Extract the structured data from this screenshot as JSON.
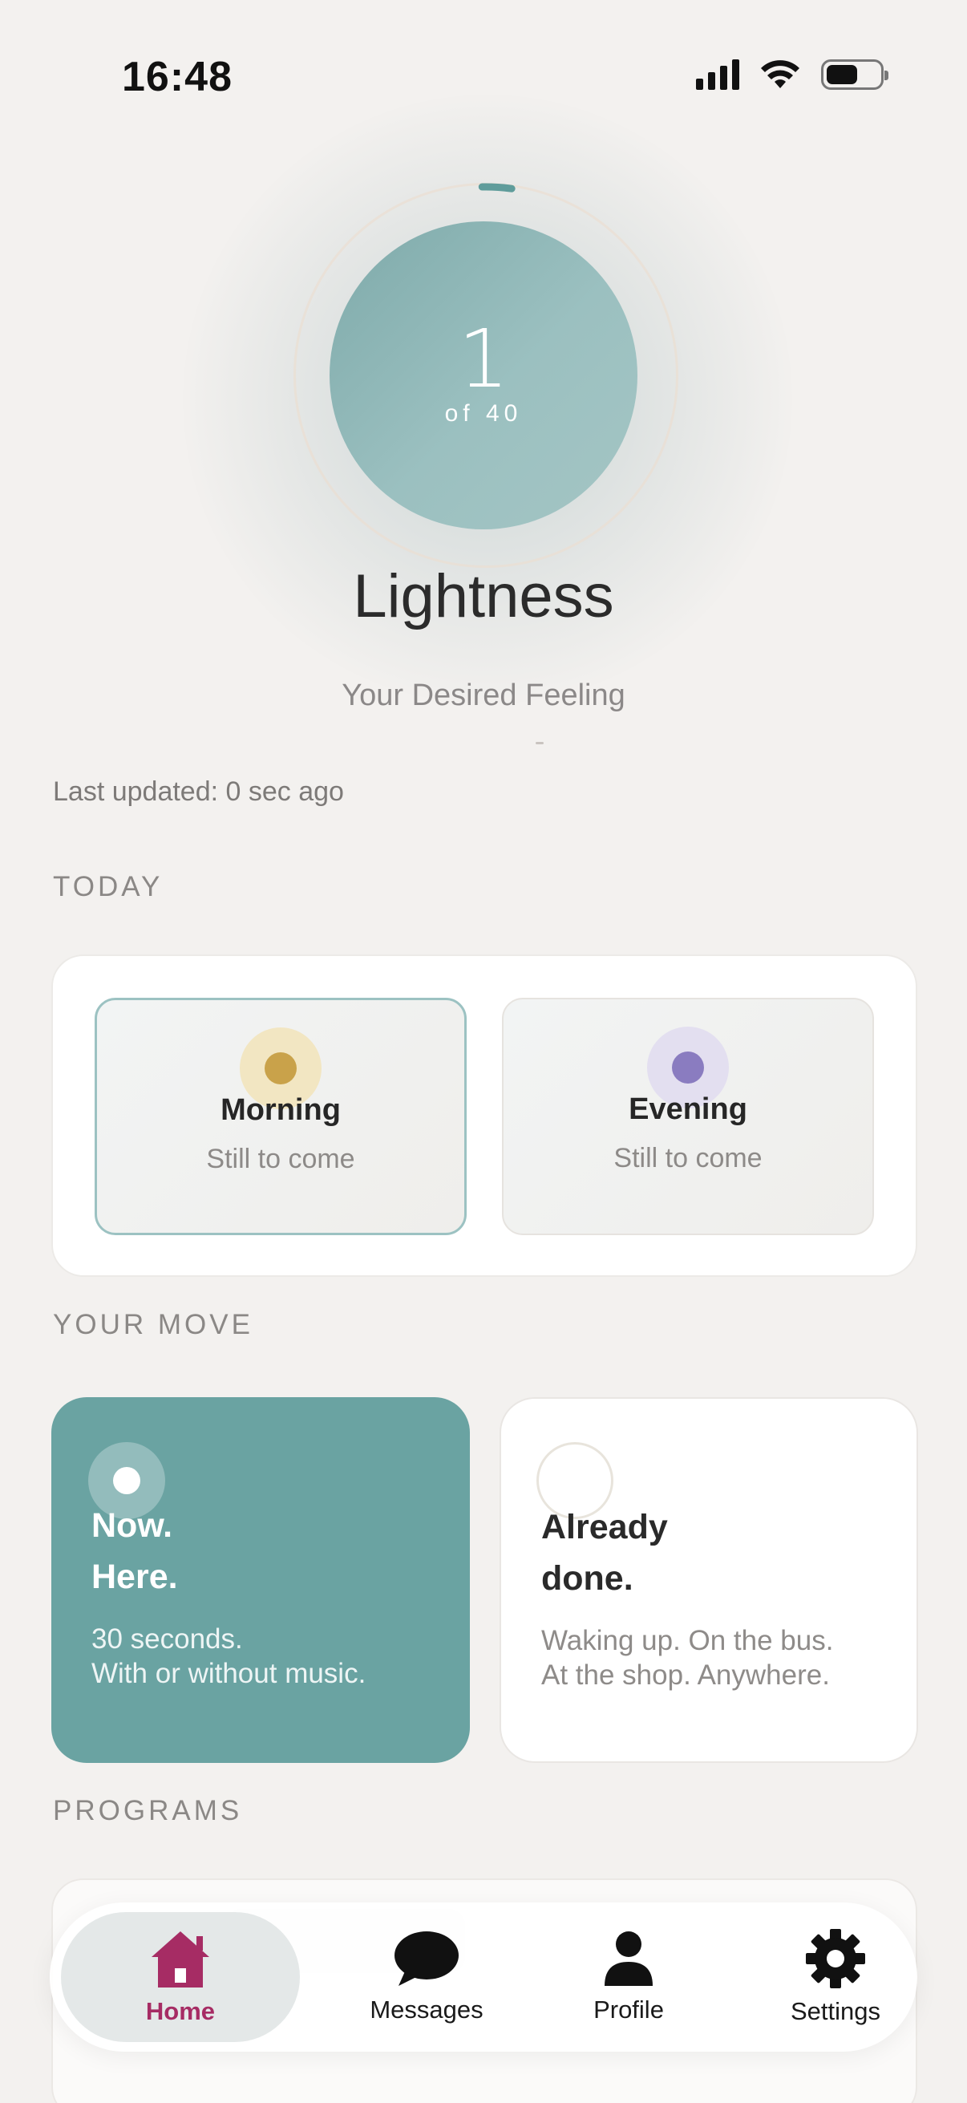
{
  "status_bar": {
    "time": "16:48"
  },
  "hero": {
    "count": "1",
    "of_label": "of 40",
    "progress_fraction": 0.025,
    "title": "Lightness",
    "subtitle": "Your Desired Feeling"
  },
  "last_updated": "Last updated: 0 sec ago",
  "today": {
    "label": "TODAY",
    "slots": [
      {
        "title": "Morning",
        "status": "Still to come",
        "accent": "#c9a24a"
      },
      {
        "title": "Evening",
        "status": "Still to come",
        "accent": "#8a7cc0"
      }
    ]
  },
  "your_move": {
    "label": "YOUR MOVE",
    "cards": [
      {
        "title_line1": "Now.",
        "title_line2": "Here.",
        "body_line1": "30 seconds.",
        "body_line2": "With or without music."
      },
      {
        "title_line1": "Already",
        "title_line2": "done.",
        "body_line1": "Waking up. On the bus.",
        "body_line2": "At the shop. Anywhere."
      }
    ]
  },
  "programs": {
    "label": "PROGRAMS"
  },
  "tabbar": {
    "items": [
      {
        "label": "Home",
        "icon": "house-icon",
        "active": true
      },
      {
        "label": "Messages",
        "icon": "chat-bubble-icon",
        "active": false
      },
      {
        "label": "Profile",
        "icon": "person-icon",
        "active": false
      },
      {
        "label": "Settings",
        "icon": "gear-icon",
        "active": false
      }
    ],
    "active_color": "#a62c64"
  },
  "colors": {
    "accent_teal": "#6aa3a2",
    "background": "#f3f1ef"
  }
}
